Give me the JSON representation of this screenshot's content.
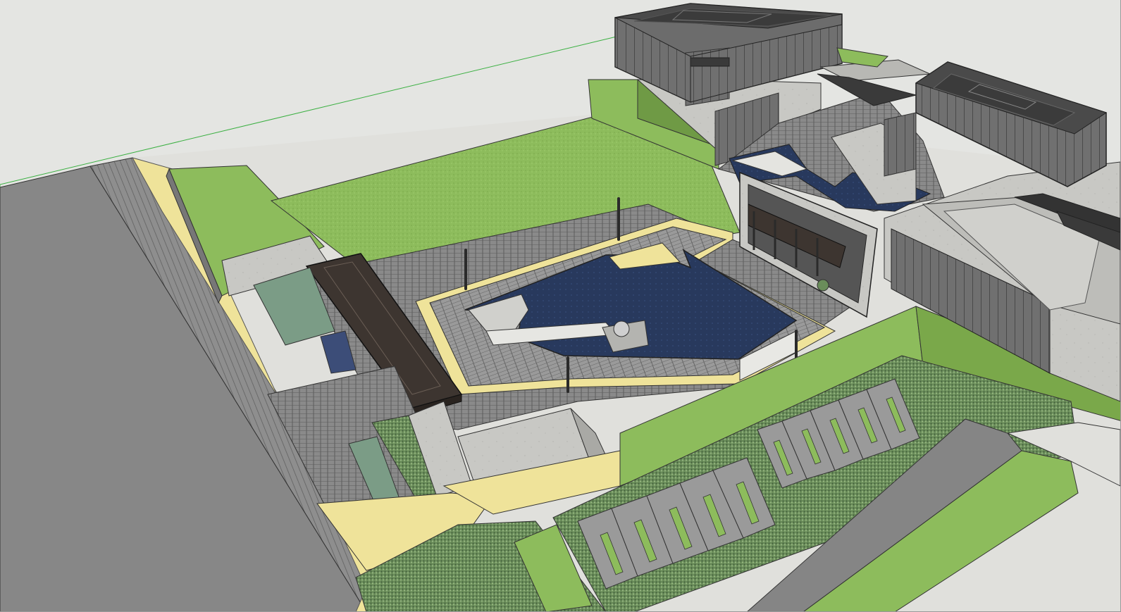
{
  "scene": {
    "description_label": "",
    "sign_text": "",
    "colors": {
      "sky": "#e4e5e2",
      "road": "#878787",
      "lawn": "#8dbc5c",
      "lawn_dark": "#6f9a45",
      "path_yellow": "#f1e69a",
      "paving": "#7c7c7c",
      "water": "#26385c",
      "building_glass": "#6e6e6e",
      "roof_dark": "#3b3b3b",
      "pergola": "#3d3530",
      "concrete": "#c9c9c5",
      "axis_green": "#3cb043"
    }
  }
}
